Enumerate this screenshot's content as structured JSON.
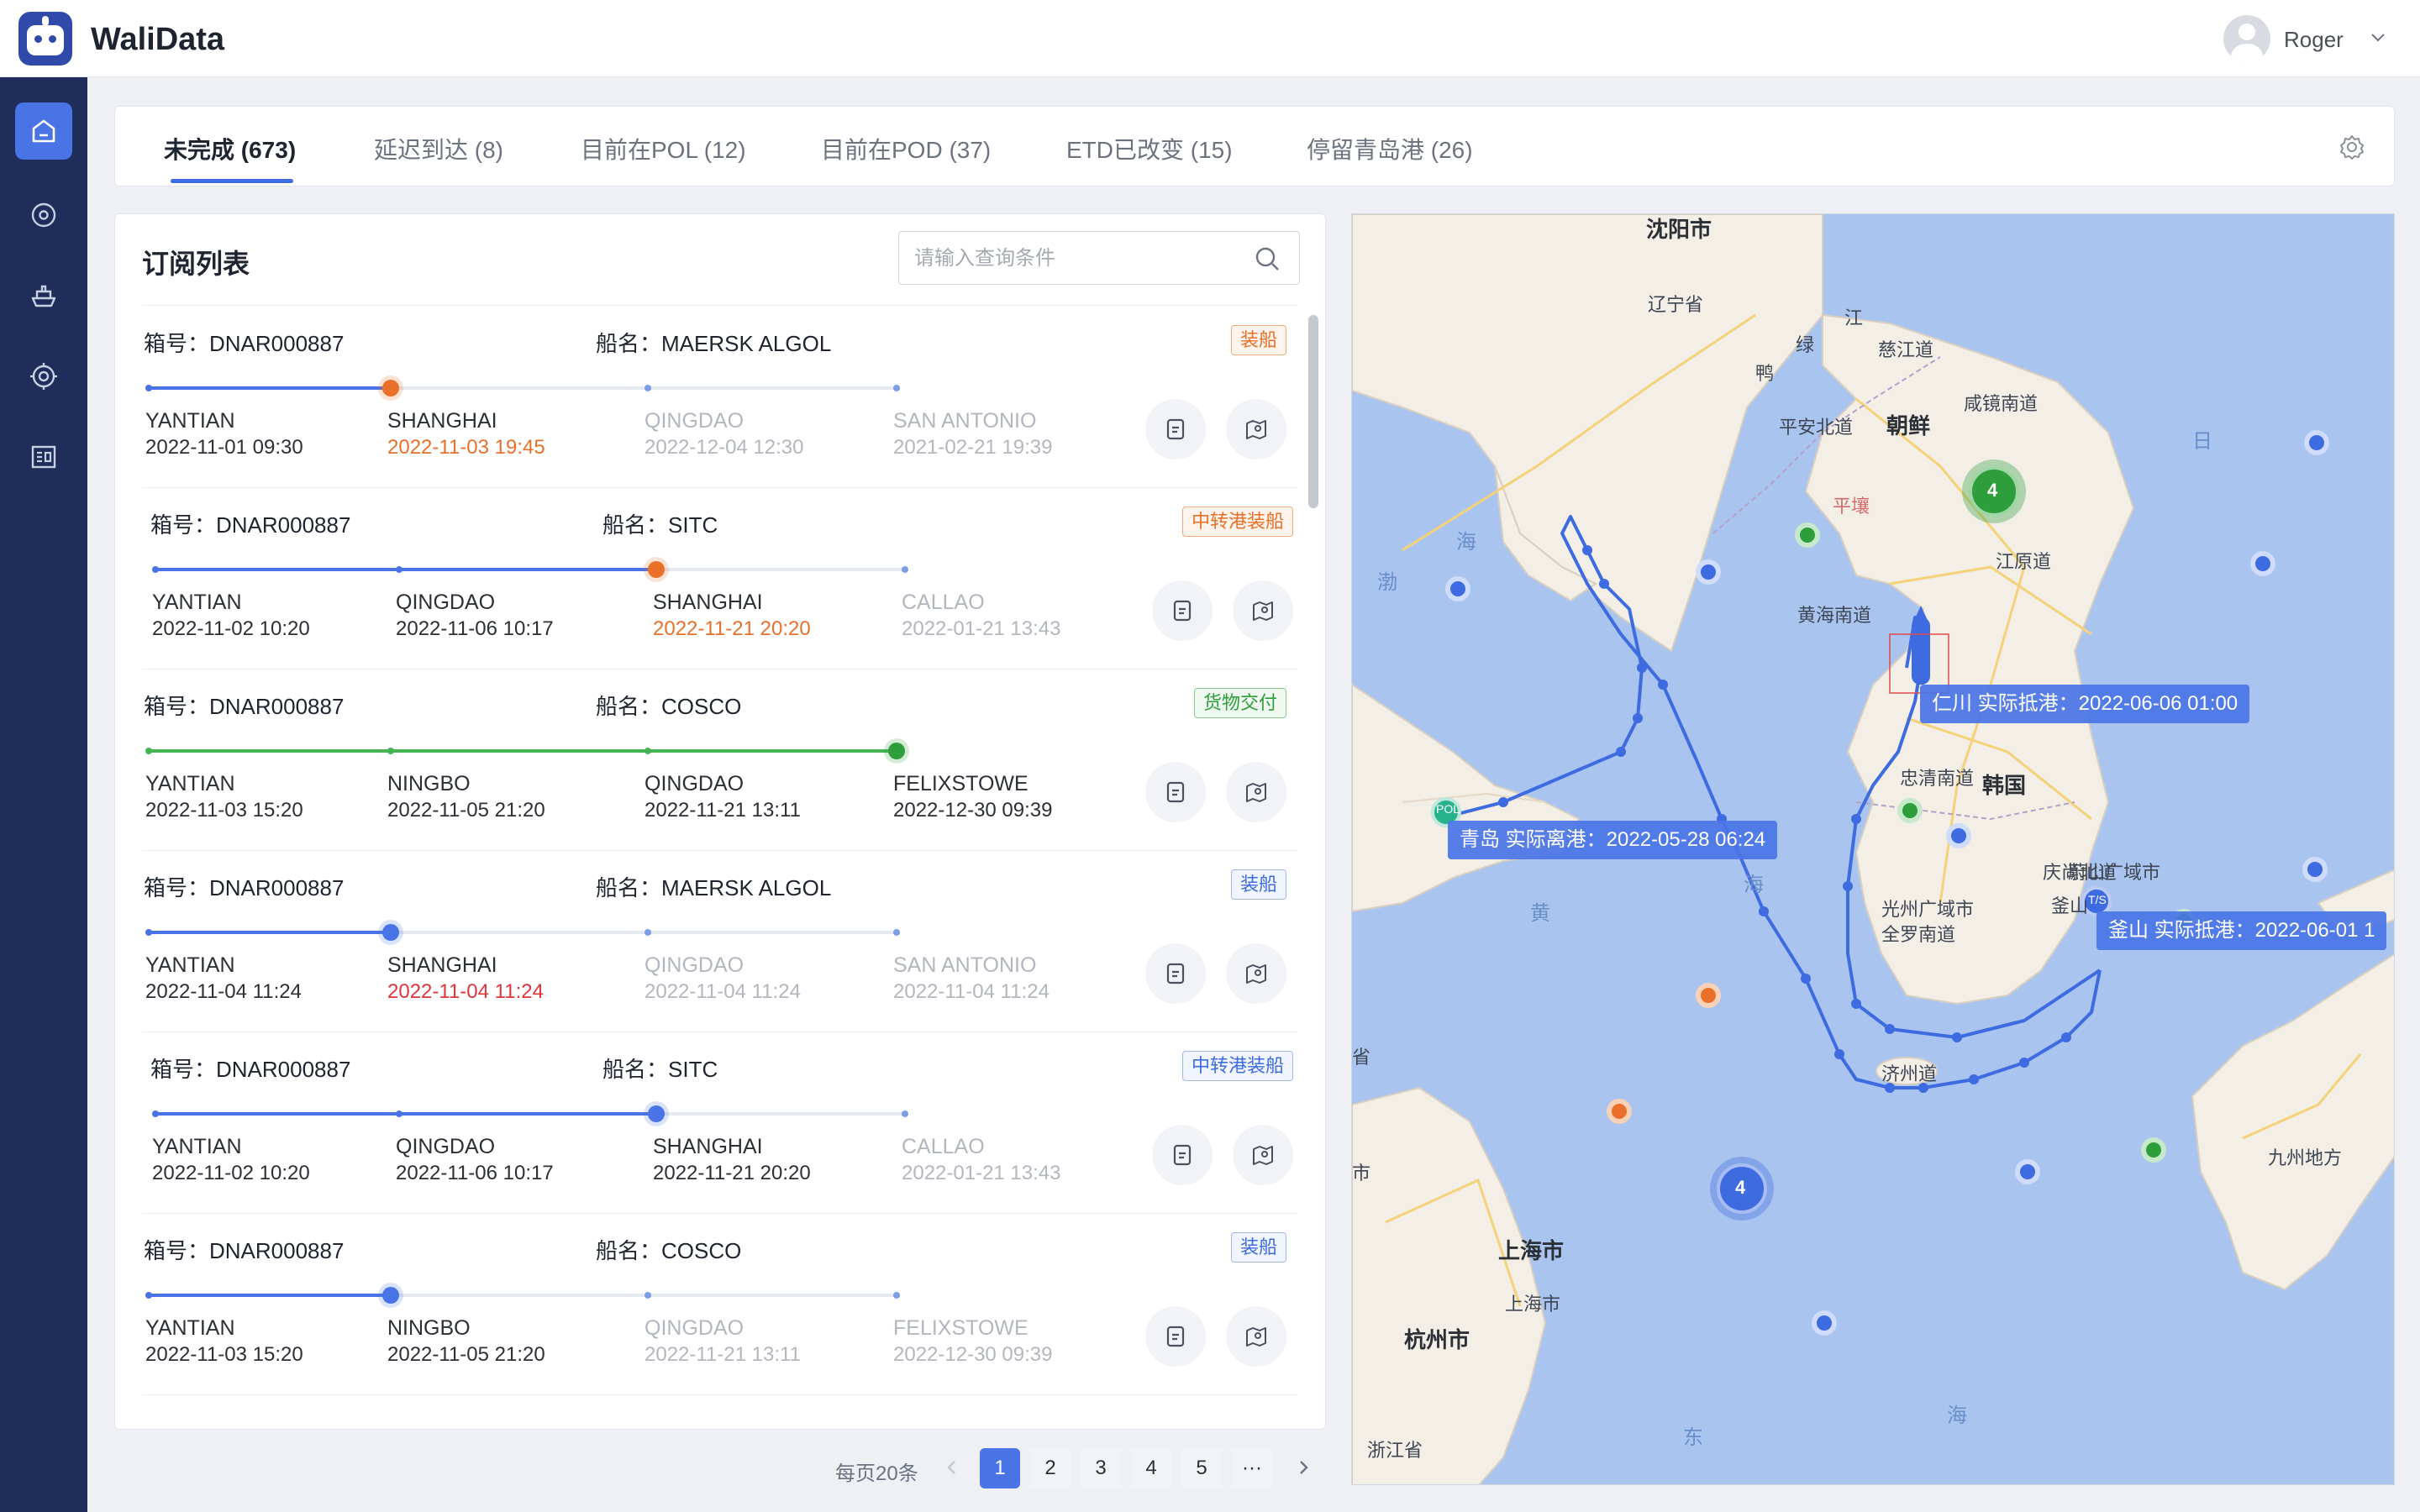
{
  "app": {
    "title": "WaliData"
  },
  "user": {
    "name": "Roger"
  },
  "sidebar": {
    "items": [
      {
        "name": "home",
        "icon": "home-icon",
        "active": true
      },
      {
        "name": "location",
        "icon": "location-pin-icon",
        "active": false
      },
      {
        "name": "vessel",
        "icon": "ship-icon",
        "active": false
      },
      {
        "name": "tracking",
        "icon": "target-icon",
        "active": false
      },
      {
        "name": "reports",
        "icon": "report-icon",
        "active": false
      }
    ]
  },
  "tabs": [
    {
      "label": "未完成 (673)"
    },
    {
      "label": "延迟到达 (8)"
    },
    {
      "label": "目前在POL (12)"
    },
    {
      "label": "目前在POD (37)"
    },
    {
      "label": "ETD已改变 (15)"
    },
    {
      "label": "停留青岛港 (26)"
    }
  ],
  "list": {
    "title": "订阅列表",
    "search_placeholder": "请输入查询条件",
    "rows": [
      {
        "container": "箱号：DNAR000887",
        "vessel": "船名：MAERSK ALGOL",
        "status": "装船",
        "status_color": "orange",
        "line_color": "blue",
        "progress_index": 1,
        "stops": [
          {
            "port": "YANTIAN",
            "time": "2022-11-01 09:30",
            "style": "dark",
            "time_style": "dark"
          },
          {
            "port": "SHANGHAI",
            "time": "2022-11-03 19:45",
            "style": "dark",
            "time_style": "orange"
          },
          {
            "port": "QINGDAO",
            "time": "2022-12-04 12:30",
            "style": "grey",
            "time_style": "grey"
          },
          {
            "port": "SAN ANTONIO",
            "time": "2021-02-21 19:39",
            "style": "grey",
            "time_style": "grey"
          }
        ],
        "current_marker": "orange"
      },
      {
        "container": "箱号：DNAR000887",
        "vessel": "船名：SITC",
        "status": "中转港装船",
        "status_color": "orange",
        "line_color": "blue",
        "progress_index": 2,
        "stops": [
          {
            "port": "YANTIAN",
            "time": "2022-11-02 10:20",
            "style": "dark",
            "time_style": "dark"
          },
          {
            "port": "QINGDAO",
            "time": "2022-11-06 10:17",
            "style": "dark",
            "time_style": "dark"
          },
          {
            "port": "SHANGHAI",
            "time": "2022-11-21 20:20",
            "style": "dark",
            "time_style": "orange"
          },
          {
            "port": "CALLAO",
            "time": "2022-01-21 13:43",
            "style": "grey",
            "time_style": "grey"
          }
        ],
        "current_marker": "orange"
      },
      {
        "container": "箱号：DNAR000887",
        "vessel": "船名：COSCO",
        "status": "货物交付",
        "status_color": "green",
        "line_color": "green",
        "progress_index": 3,
        "stops": [
          {
            "port": "YANTIAN",
            "time": "2022-11-03 15:20",
            "style": "dark",
            "time_style": "dark"
          },
          {
            "port": "NINGBO",
            "time": "2022-11-05 21:20",
            "style": "dark",
            "time_style": "dark"
          },
          {
            "port": "QINGDAO",
            "time": "2022-11-21 13:11",
            "style": "dark",
            "time_style": "dark"
          },
          {
            "port": "FELIXSTOWE",
            "time": "2022-12-30 09:39",
            "style": "dark",
            "time_style": "dark"
          }
        ],
        "current_marker": "green"
      },
      {
        "container": "箱号：DNAR000887",
        "vessel": "船名：MAERSK ALGOL",
        "status": "装船",
        "status_color": "blue",
        "line_color": "blue",
        "progress_index": 1,
        "stops": [
          {
            "port": "YANTIAN",
            "time": "2022-11-04 11:24",
            "style": "dark",
            "time_style": "dark"
          },
          {
            "port": "SHANGHAI",
            "time": "2022-11-04 11:24",
            "style": "dark",
            "time_style": "red"
          },
          {
            "port": "QINGDAO",
            "time": "2022-11-04 11:24",
            "style": "grey",
            "time_style": "grey"
          },
          {
            "port": "SAN ANTONIO",
            "time": "2022-11-04 11:24",
            "style": "grey",
            "time_style": "grey"
          }
        ],
        "current_marker": "blue"
      },
      {
        "container": "箱号：DNAR000887",
        "vessel": "船名：SITC",
        "status": "中转港装船",
        "status_color": "blue",
        "line_color": "blue",
        "progress_index": 2,
        "stops": [
          {
            "port": "YANTIAN",
            "time": "2022-11-02 10:20",
            "style": "dark",
            "time_style": "dark"
          },
          {
            "port": "QINGDAO",
            "time": "2022-11-06 10:17",
            "style": "dark",
            "time_style": "dark"
          },
          {
            "port": "SHANGHAI",
            "time": "2022-11-21 20:20",
            "style": "dark",
            "time_style": "dark"
          },
          {
            "port": "CALLAO",
            "time": "2022-01-21 13:43",
            "style": "grey",
            "time_style": "grey"
          }
        ],
        "current_marker": "blue"
      },
      {
        "container": "箱号：DNAR000887",
        "vessel": "船名：COSCO",
        "status": "装船",
        "status_color": "blue",
        "line_color": "blue",
        "progress_index": 1,
        "stops": [
          {
            "port": "YANTIAN",
            "time": "2022-11-03 15:20",
            "style": "dark",
            "time_style": "dark"
          },
          {
            "port": "NINGBO",
            "time": "2022-11-05 21:20",
            "style": "dark",
            "time_style": "dark"
          },
          {
            "port": "QINGDAO",
            "time": "2022-11-21 13:11",
            "style": "grey",
            "time_style": "grey"
          },
          {
            "port": "FELIXSTOWE",
            "time": "2022-12-30 09:39",
            "style": "grey",
            "time_style": "grey"
          }
        ],
        "current_marker": "blue"
      }
    ]
  },
  "pagination": {
    "per_page_label": "每页20条",
    "pages": [
      "1",
      "2",
      "3",
      "4",
      "5",
      "···"
    ],
    "active_page": "1"
  },
  "map": {
    "labels": [
      {
        "text": "沈阳市",
        "style": "big"
      },
      {
        "text": "辽宁省",
        "style": "normal"
      },
      {
        "text": "江",
        "style": "normal"
      },
      {
        "text": "慈江道",
        "style": "normal"
      },
      {
        "text": "绿",
        "style": "normal"
      },
      {
        "text": "鸭",
        "style": "normal"
      },
      {
        "text": "咸镜南道",
        "style": "normal"
      },
      {
        "text": "平安北道",
        "style": "normal"
      },
      {
        "text": "朝鲜",
        "style": "big"
      },
      {
        "text": "平壤",
        "style": "red"
      },
      {
        "text": "江原道",
        "style": "normal"
      },
      {
        "text": "黄海南道",
        "style": "normal"
      },
      {
        "text": "忠清南道",
        "style": "normal"
      },
      {
        "text": "韩国",
        "style": "big"
      },
      {
        "text": "庆尚北道",
        "style": "normal"
      },
      {
        "text": "光州广域市",
        "style": "normal"
      },
      {
        "text": "全罗南道",
        "style": "normal"
      },
      {
        "text": "蔚山广域市",
        "style": "normal"
      },
      {
        "text": "釜山",
        "style": "normal"
      },
      {
        "text": "济州道",
        "style": "normal"
      },
      {
        "text": "九州地方",
        "style": "normal"
      },
      {
        "text": "上海市",
        "style": "big"
      },
      {
        "text": "上海市",
        "style": "normal"
      },
      {
        "text": "杭州市",
        "style": "big"
      },
      {
        "text": "浙江省",
        "style": "normal"
      },
      {
        "text": "海",
        "style": "sea"
      },
      {
        "text": "渤",
        "style": "sea"
      },
      {
        "text": "海",
        "style": "sea"
      },
      {
        "text": "黄",
        "style": "sea"
      },
      {
        "text": "海",
        "style": "sea"
      },
      {
        "text": "东",
        "style": "sea"
      },
      {
        "text": "海",
        "style": "sea"
      },
      {
        "text": "日",
        "style": "sea"
      },
      {
        "text": "省",
        "style": "normal"
      },
      {
        "text": "市",
        "style": "normal"
      }
    ],
    "tooltips": [
      {
        "text": "仁川 实际抵港：2022-06-06 01:00"
      },
      {
        "text": "青岛  实际离港：2022-05-28 06:24"
      },
      {
        "text": "釜山  实际抵港：2022-06-01 1"
      }
    ],
    "marker_labels": {
      "pol": "POL",
      "ts": "T/S",
      "cluster_a": "4",
      "cluster_b": "4"
    }
  },
  "colors": {
    "accent": "#4a74e6",
    "sidebar": "#1f2d5a",
    "orange": "#e8702a",
    "green": "#2e9d3b",
    "red": "#e0353a"
  }
}
